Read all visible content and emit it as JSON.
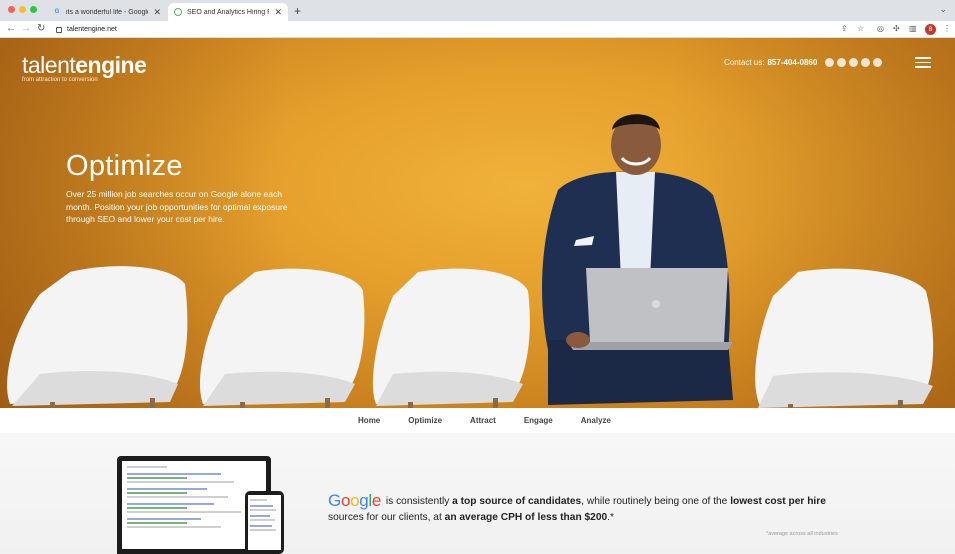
{
  "browser": {
    "tabs": [
      {
        "title": "its a wonderful life - Google Se",
        "favicon": "google-icon",
        "active": false
      },
      {
        "title": "SEO and Analytics Hiring Platfo",
        "favicon": "talentengine-icon",
        "active": true
      }
    ],
    "url": "talentengine.net",
    "profile_initial": "B"
  },
  "header": {
    "logo_word_a": "talent",
    "logo_word_b": "engine",
    "logo_tagline": "from attraction to conversion",
    "contact_label": "Contact us:",
    "contact_phone": "857-404-0860",
    "social_icons": [
      "email-icon",
      "facebook-icon",
      "twitter-icon",
      "linkedin-icon",
      "youtube-icon"
    ]
  },
  "hero": {
    "title": "Optimize",
    "body": "Over 25 million job searches occur on Google alone each month. Position your job opportunities for optimal exposure through SEO and lower your cost per hire.",
    "background_color": "#e5a02c"
  },
  "nav": {
    "items": [
      "Home",
      "Optimize",
      "Attract",
      "Engage",
      "Analyze"
    ]
  },
  "lower": {
    "google_word": "Google",
    "text_1": "is consistently",
    "text_2": "a top source of candidates",
    "text_3": ", while routinely being one of the",
    "text_4": "lowest cost per hire",
    "text_5": "sources for our clients, at",
    "text_6": "an average CPH of less than $200",
    "text_7": ".*",
    "footnote": "*average across all industries"
  }
}
